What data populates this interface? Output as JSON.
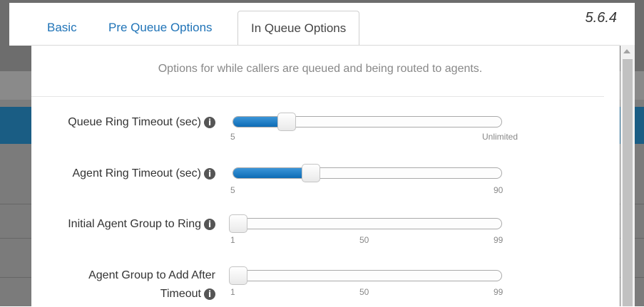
{
  "tabs": [
    {
      "label": "Basic",
      "active": false
    },
    {
      "label": "Pre Queue Options",
      "active": false
    },
    {
      "label": "In Queue Options",
      "active": true
    }
  ],
  "version": "5.6.4",
  "intro": "Options for while callers are queued and being routed to agents.",
  "info_icon": "info-icon",
  "accent_color": "#1f73b7",
  "sliders": [
    {
      "label": "Queue Ring Timeout (sec)",
      "min_label": "5",
      "mid_label": "",
      "max_label": "Unlimited",
      "value_fraction": 0.2
    },
    {
      "label": "Agent Ring Timeout (sec)",
      "min_label": "5",
      "mid_label": "",
      "max_label": "90",
      "value_fraction": 0.29
    },
    {
      "label": "Initial Agent Group to Ring",
      "min_label": "1",
      "mid_label": "50",
      "max_label": "99",
      "value_fraction": 0.0
    },
    {
      "label_line1": "Agent Group to Add After",
      "label_line2": "Timeout",
      "min_label": "1",
      "mid_label": "50",
      "max_label": "99",
      "value_fraction": 0.0
    }
  ]
}
